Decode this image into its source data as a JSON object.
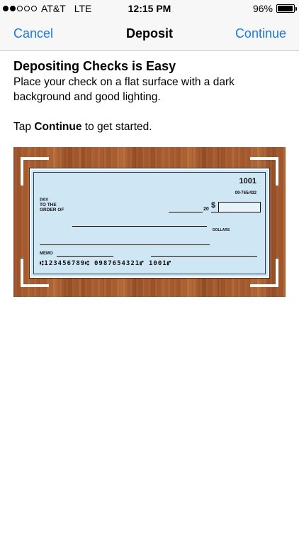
{
  "status_bar": {
    "carrier": "AT&T",
    "network": "LTE",
    "time": "12:15 PM",
    "battery": "96%",
    "battery_level": 0.96
  },
  "nav": {
    "cancel": "Cancel",
    "title": "Deposit",
    "continue": "Continue"
  },
  "content": {
    "heading": "Depositing Checks is Easy",
    "description": "Place your check on a flat surface with a dark background and good lighting.",
    "tap_prefix": "Tap ",
    "tap_bold": "Continue",
    "tap_suffix": " to get started."
  },
  "check": {
    "number": "1001",
    "routing_fraction": "09-765/432",
    "year_suffix": "20",
    "pay_line": "PAY\nTO THE\nORDER OF",
    "dollar_sign": "$",
    "dollars_label": "DOLLARS",
    "memo_label": "MEMO",
    "micr": "⑆123456789⑆  0987654321⑈  1001⑈"
  },
  "colors": {
    "link": "#1a7ae0",
    "check_background": "#cfe6f5",
    "wood": "#a45a2c"
  }
}
